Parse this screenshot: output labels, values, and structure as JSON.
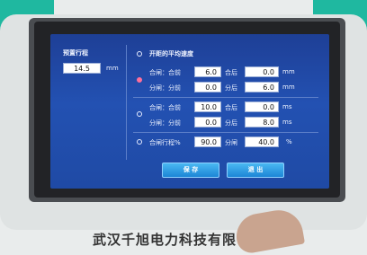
{
  "stroke_preset": {
    "label": "预置行程",
    "value": "14.5",
    "unit": "mm"
  },
  "avg_speed_title": "开距的平均速度",
  "group1": {
    "row1": {
      "a_label": "合闸：合前",
      "a_value": "6.0",
      "b_label": "合后",
      "b_value": "0.0",
      "unit": "mm"
    },
    "row2": {
      "a_label": "分闸：分前",
      "a_value": "0.0",
      "b_label": "分后",
      "b_value": "6.0",
      "unit": "mm"
    }
  },
  "group2": {
    "row1": {
      "a_label": "合闸：合前",
      "a_value": "10.0",
      "b_label": "合后",
      "b_value": "0.0",
      "unit": "ms"
    },
    "row2": {
      "a_label": "分闸：分前",
      "a_value": "0.0",
      "b_label": "分后",
      "b_value": "8.0",
      "unit": "ms"
    }
  },
  "group3": {
    "a_label": "合闸行程%",
    "a_value": "90.0",
    "b_label": "分闸",
    "b_value": "40.0",
    "unit": "%"
  },
  "buttons": {
    "save": "保 存",
    "exit": "退 出"
  },
  "brand": "武汉千旭电力科技有限公司",
  "colors": {
    "screen": "#2351b2",
    "button": "#1c86d6",
    "selected_radio": "#ff6f9a"
  }
}
